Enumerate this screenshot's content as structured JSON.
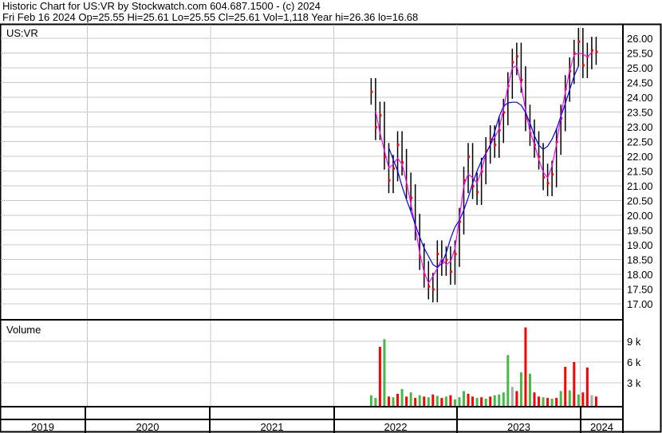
{
  "header": {
    "title": "Historic Chart for US:VR by Stockwatch.com 604.687.1500 - (c) 2024",
    "quote": "Fri Feb 16 2024  Op=25.55  Hi=25.61  Lo=25.55  Cl=25.61  Vol=1,118  Year hi=26.36  lo=16.68"
  },
  "colors": {
    "candle": "#000000",
    "close_tick": "#ff0000",
    "ma_short": "#ff00ff",
    "ma_long": "#0000ff",
    "vol_up": "#44bb44",
    "vol_down": "#ff0000",
    "vol_flat": "#aaaaaa",
    "grid": "#c8c8c8"
  },
  "chart_data": {
    "type": "line",
    "symbol_label": "US:VR",
    "volume_label": "Volume",
    "price_ticks": [
      "17.00",
      "17.50",
      "18.00",
      "18.50",
      "19.00",
      "19.50",
      "20.00",
      "20.50",
      "21.00",
      "21.50",
      "22.00",
      "22.50",
      "23.00",
      "23.50",
      "24.00",
      "24.50",
      "25.00",
      "25.50",
      "26.00"
    ],
    "volume_ticks": [
      {
        "label": "3 k",
        "value": 3
      },
      {
        "label": "6 k",
        "value": 6
      },
      {
        "label": "9 k",
        "value": 9
      }
    ],
    "years": [
      "2019",
      "2020",
      "2021",
      "2022",
      "2023",
      "2024"
    ],
    "x_start_year": 2022.3,
    "x_step_years": 0.0358,
    "typical_range": 0.45,
    "closes": [
      24.2,
      23.0,
      23.4,
      22.0,
      21.2,
      21.6,
      22.4,
      21.8,
      21.0,
      20.6,
      19.6,
      18.6,
      18.0,
      17.6,
      17.5,
      18.7,
      18.4,
      18.5,
      18.1,
      18.7,
      19.8,
      21.2,
      22.0,
      21.0,
      20.8,
      21.5,
      22.2,
      22.6,
      22.4,
      22.9,
      23.5,
      24.4,
      25.2,
      25.4,
      24.6,
      23.3,
      22.8,
      22.4,
      22.0,
      21.3,
      21.1,
      21.4,
      22.5,
      23.3,
      24.3,
      24.9,
      25.5,
      25.9,
      25.1,
      25.4,
      25.6,
      25.55
    ],
    "volume_k": [
      1.2,
      0.8,
      8.2,
      9.3,
      1.0,
      0.9,
      1.4,
      2.1,
      1.0,
      1.6,
      0.8,
      1.2,
      1.0,
      0.9,
      1.3,
      1.1,
      0.8,
      1.0,
      1.2,
      0.6,
      0.9,
      1.8,
      1.4,
      1.0,
      0.8,
      0.9,
      0.7,
      1.0,
      1.2,
      1.3,
      1.6,
      7.0,
      2.4,
      1.8,
      4.5,
      11.0,
      4.3,
      1.6,
      1.0,
      0.9,
      0.8,
      0.7,
      0.8,
      1.8,
      5.3,
      1.9,
      6.0,
      1.3,
      1.6,
      5.2,
      1.2,
      1.0
    ],
    "volume_dir": [
      "up",
      "up",
      "down",
      "up",
      "down",
      "up",
      "down",
      "up",
      "down",
      "up",
      "down",
      "up",
      "down",
      "up",
      "down",
      "up",
      "down",
      "up",
      "down",
      "up",
      "up",
      "up",
      "down",
      "down",
      "up",
      "down",
      "up",
      "down",
      "up",
      "up",
      "up",
      "up",
      "flat",
      "down",
      "up",
      "down",
      "up",
      "down",
      "down",
      "up",
      "down",
      "up",
      "down",
      "up",
      "down",
      "up",
      "down",
      "up",
      "down",
      "down",
      "flat",
      "down"
    ],
    "ylim": [
      16.5,
      26.5
    ],
    "ma_short_period": 3,
    "ma_long_period": 9
  }
}
